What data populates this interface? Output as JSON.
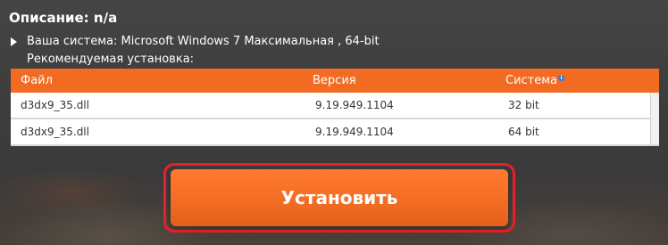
{
  "description": {
    "text": "Описание: n/a"
  },
  "system": {
    "text": "Ваша система: Microsoft Windows 7 Максимальная , 64-bit"
  },
  "recommended": {
    "text": "Рекомендуемая установка:"
  },
  "table": {
    "headers": [
      "Файл",
      "Версия",
      "Система"
    ],
    "rows": [
      {
        "file": "d3dx9_35.dll",
        "version": "9.19.949.1104",
        "system": "32 bit"
      },
      {
        "file": "d3dx9_35.dll",
        "version": "9.19.949.1104",
        "system": "64 bit"
      }
    ]
  },
  "install_button": {
    "label": "Установить"
  },
  "colors": {
    "accent": "#f26b22",
    "highlight": "#e8202a",
    "background": "#3d3d3d"
  },
  "icons": {
    "info": "info-icon",
    "expand": "triangle-right-icon"
  }
}
